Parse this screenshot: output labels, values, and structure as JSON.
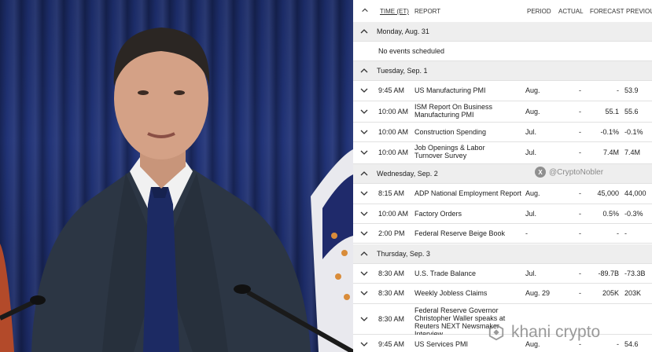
{
  "calendar": {
    "headers": {
      "time": "TIME (ET)",
      "report": "REPORT",
      "period": "PERIOD",
      "actual": "ACTUAL",
      "forecast": "FORECAST",
      "previous": "PREVIOUS"
    },
    "days": [
      {
        "label": "Monday, Aug. 31",
        "empty_text": "No events scheduled",
        "events": []
      },
      {
        "label": "Tuesday, Sep. 1",
        "events": [
          {
            "time": "9:45 AM",
            "report": "US Manufacturing PMI",
            "period": "Aug.",
            "actual": "-",
            "forecast": "-",
            "previous": "53.9"
          },
          {
            "time": "10:00 AM",
            "report": "ISM Report On Business Manufacturing PMI",
            "period": "Aug.",
            "actual": "-",
            "forecast": "55.1",
            "previous": "55.6"
          },
          {
            "time": "10:00 AM",
            "report": "Construction Spending",
            "period": "Jul.",
            "actual": "-",
            "forecast": "-0.1%",
            "previous": "-0.1%"
          },
          {
            "time": "10:00 AM",
            "report": "Job Openings & Labor Turnover Survey",
            "period": "Jul.",
            "actual": "-",
            "forecast": "7.4M",
            "previous": "7.4M"
          }
        ]
      },
      {
        "label": "Wednesday, Sep. 2",
        "events": [
          {
            "time": "8:15 AM",
            "report": "ADP National Employment Report",
            "period": "Aug.",
            "actual": "-",
            "forecast": "45,000",
            "previous": "44,000"
          },
          {
            "time": "10:00 AM",
            "report": "Factory Orders",
            "period": "Jul.",
            "actual": "-",
            "forecast": "0.5%",
            "previous": "-0.3%"
          },
          {
            "time": "2:00 PM",
            "report": "Federal Reserve Beige Book",
            "period": "-",
            "actual": "-",
            "forecast": "-",
            "previous": "-"
          }
        ]
      },
      {
        "label": "Thursday, Sep. 3",
        "events": [
          {
            "time": "8:30 AM",
            "report": "U.S. Trade Balance",
            "period": "Jul.",
            "actual": "-",
            "forecast": "-89.7B",
            "previous": "-73.3B"
          },
          {
            "time": "8:30 AM",
            "report": "Weekly Jobless Claims",
            "period": "Aug. 29",
            "actual": "-",
            "forecast": "205K",
            "previous": "203K"
          },
          {
            "time": "8:30 AM",
            "report": "Federal Reserve Governor Christopher Waller speaks at Reuters NEXT Newsmaker Interview",
            "period": "",
            "actual": "",
            "forecast": "",
            "previous": ""
          },
          {
            "time": "9:45 AM",
            "report": "US Services PMI",
            "period": "Aug.",
            "actual": "-",
            "forecast": "-",
            "previous": "54.6"
          }
        ]
      }
    ]
  },
  "watermarks": {
    "handle": "@CryptoNobler",
    "x_badge": "X",
    "brand": "khani crypto"
  },
  "colors": {
    "day_row_bg": "#eeeeee",
    "divider": "#e1e1e1",
    "text": "#1c1c1c",
    "curtain_blue": "#213377"
  },
  "icons": {
    "expand": "chevron-down-icon",
    "collapse": "chevron-up-icon"
  }
}
